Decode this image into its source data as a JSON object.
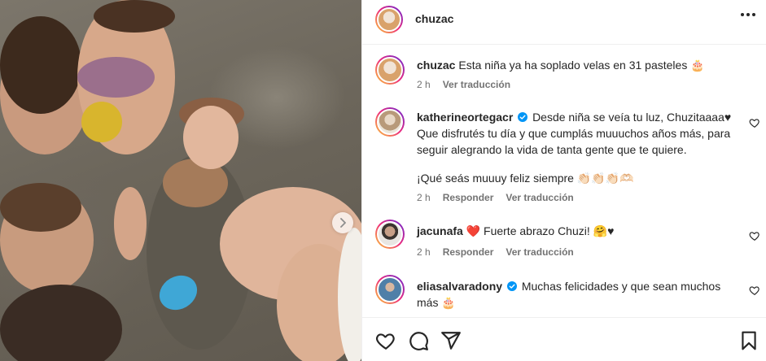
{
  "post": {
    "username": "chuzac",
    "avatar_colors": [
      "#d9a26b",
      "#f1e3d6"
    ]
  },
  "comments": [
    {
      "username": "chuzac",
      "text": "Esta niña ya ha soplado velas en 31 pasteles 🎂",
      "time": "2 h",
      "translate": "Ver traducción",
      "verified": false
    },
    {
      "username": "katherineortegacr",
      "text_line1": "Desde niña se veía tu luz, Chuzitaaaa♥",
      "text_line2": "Que disfrutés tu día y que cumplás muuuchos años más, para",
      "text_line3": "seguir alegrando la vida de tanta gente que te quiere.",
      "text_line4": "¡Qué seás muuuy feliz siempre 👏🏻👏🏻👏🏻🫶🏻",
      "time": "2 h",
      "reply": "Responder",
      "translate": "Ver traducción",
      "verified": true
    },
    {
      "username": "jacunafa",
      "text": "❤️ Fuerte abrazo Chuzi! 🤗♥",
      "time": "2 h",
      "reply": "Responder",
      "translate": "Ver traducción",
      "verified": false
    },
    {
      "username": "eliasalvaradony",
      "text_line1": "Muchas felicidades y que sean muchos",
      "text_line2": "más 🎂",
      "verified": true
    }
  ],
  "icons": {
    "more": "more-options-icon",
    "like": "heart-icon",
    "comment": "comment-icon",
    "share": "share-icon",
    "save": "bookmark-icon",
    "next": "chevron-right-icon",
    "verified": "verified-badge-icon"
  },
  "colors": {
    "verified": "#0095f6",
    "meta_text": "#737373",
    "text": "#262626",
    "story_ring_start": "#f9ce34",
    "story_ring_mid": "#ee2a7b",
    "story_ring_end": "#6228d7"
  }
}
